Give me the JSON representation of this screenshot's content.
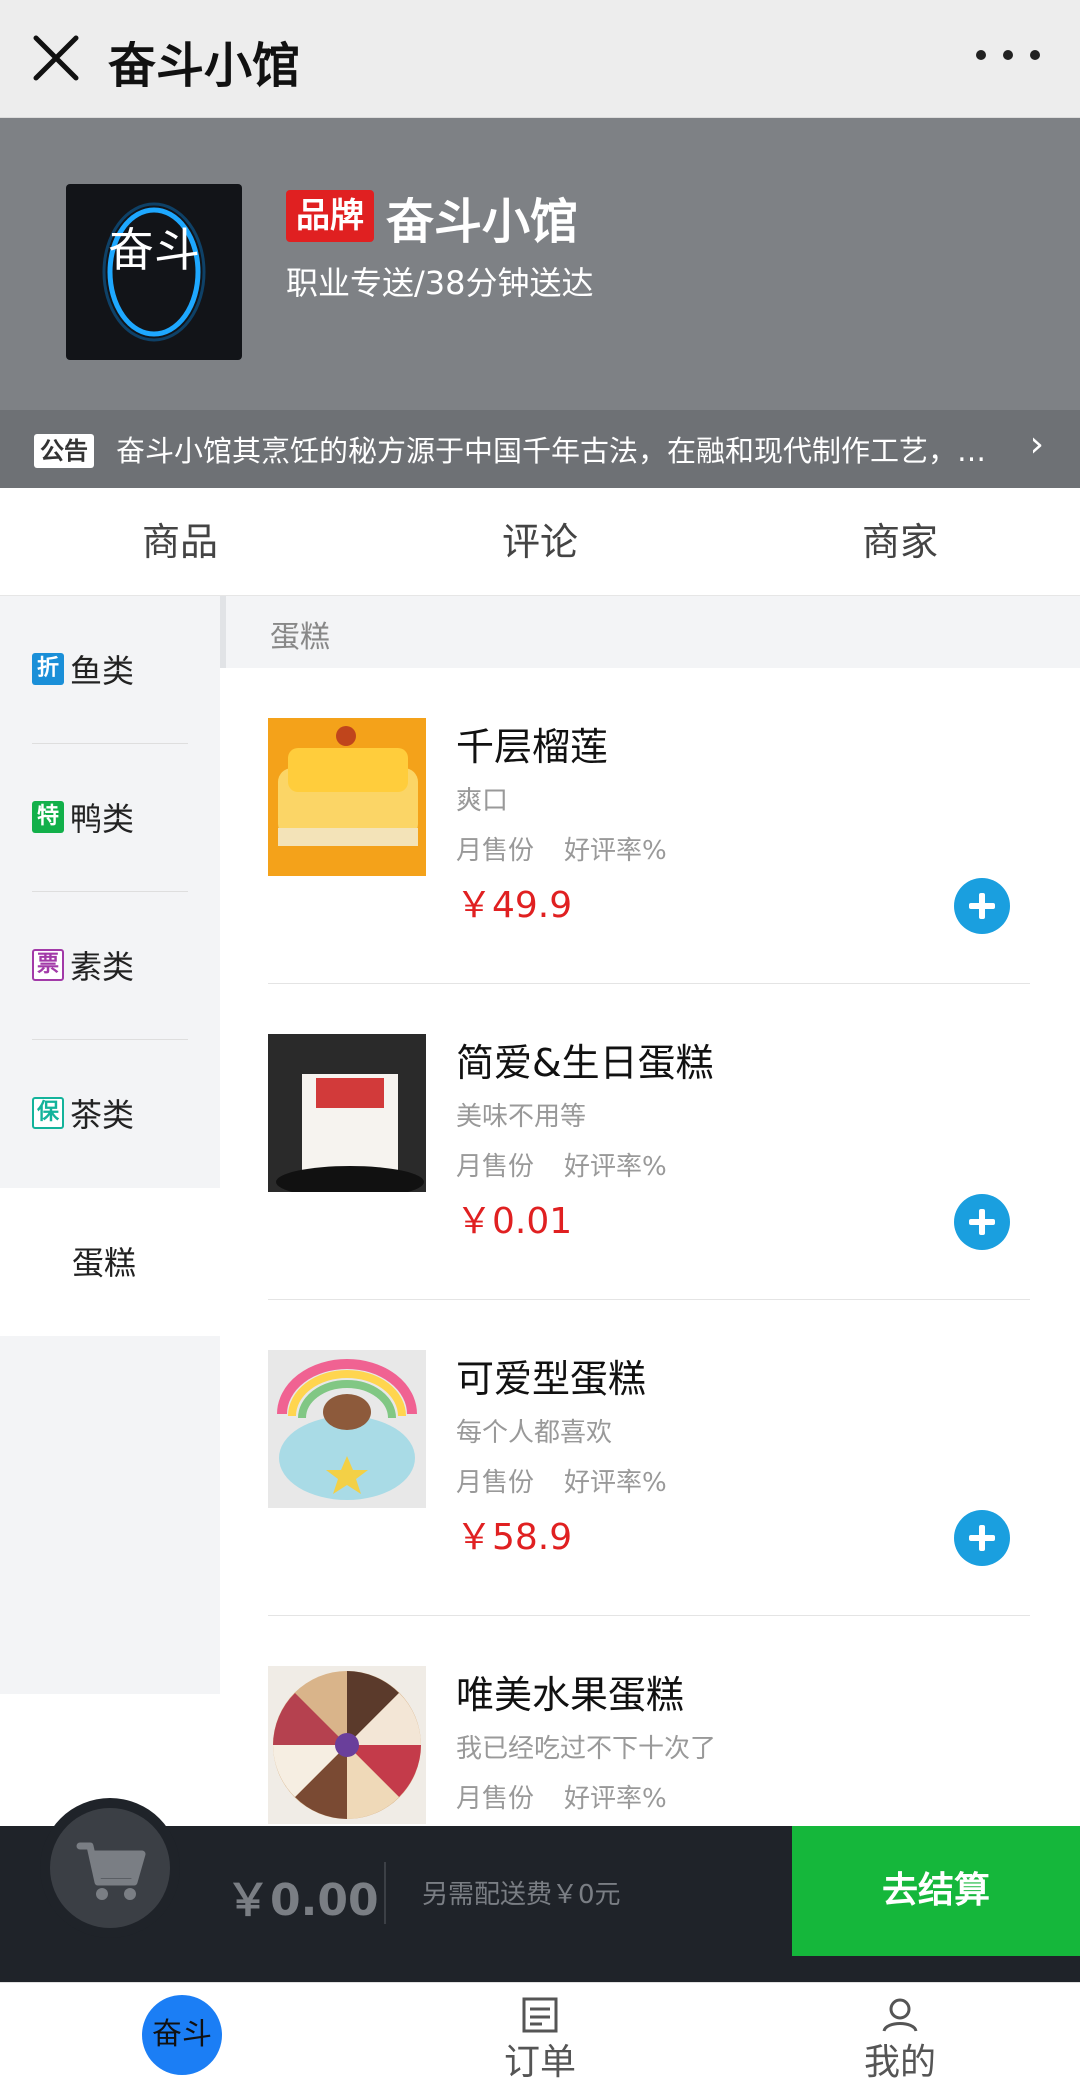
{
  "topbar": {
    "title": "奋斗小馆"
  },
  "shop": {
    "badge": "品牌",
    "name": "奋斗小馆",
    "delivery": "职业专送/38分钟送达",
    "logo_text": "奋斗"
  },
  "notice": {
    "tag": "公告",
    "text": "奋斗小馆其烹饪的秘方源于中国千年古法，在融和现代制作工艺，由世...",
    "arrow": "›"
  },
  "tabs": [
    {
      "label": "商品"
    },
    {
      "label": "评论"
    },
    {
      "label": "商家"
    }
  ],
  "categories": [
    {
      "tag": "折",
      "tag_color": "#1a8fd8",
      "label": "鱼类"
    },
    {
      "tag": "特",
      "tag_color": "#12b04a",
      "label": "鸭类"
    },
    {
      "tag": "票",
      "tag_color": "#a23aa8",
      "label": "素类"
    },
    {
      "tag": "保",
      "tag_color": "#13b39b",
      "label": "茶类"
    },
    {
      "tag": "",
      "tag_color": "",
      "label": "蛋糕"
    }
  ],
  "section": {
    "title": "蛋糕"
  },
  "products": [
    {
      "name": "千层榴莲",
      "desc": "爽口",
      "monthly": "月售份",
      "rating": "好评率%",
      "price": "￥49.9"
    },
    {
      "name": "简爱&生日蛋糕",
      "desc": "美味不用等",
      "monthly": "月售份",
      "rating": "好评率%",
      "price": "￥0.01"
    },
    {
      "name": "可爱型蛋糕",
      "desc": "每个人都喜欢",
      "monthly": "月售份",
      "rating": "好评率%",
      "price": "￥58.9"
    },
    {
      "name": "唯美水果蛋糕",
      "desc": "我已经吃过不下十次了",
      "monthly": "月售份",
      "rating": "好评率%",
      "price": ""
    }
  ],
  "cart": {
    "total": "￥0.00",
    "fee_note": "另需配送费￥0元",
    "checkout_label": "去结算"
  },
  "bottom_nav": [
    {
      "label": "奋斗",
      "icon": "home-bubble"
    },
    {
      "label": "订单",
      "icon": "order-icon"
    },
    {
      "label": "我的",
      "icon": "user-icon"
    }
  ],
  "colors": {
    "price": "#e02021",
    "add_button": "#1a9fdf",
    "checkout": "#15b73b",
    "brand_badge": "#e02021"
  }
}
